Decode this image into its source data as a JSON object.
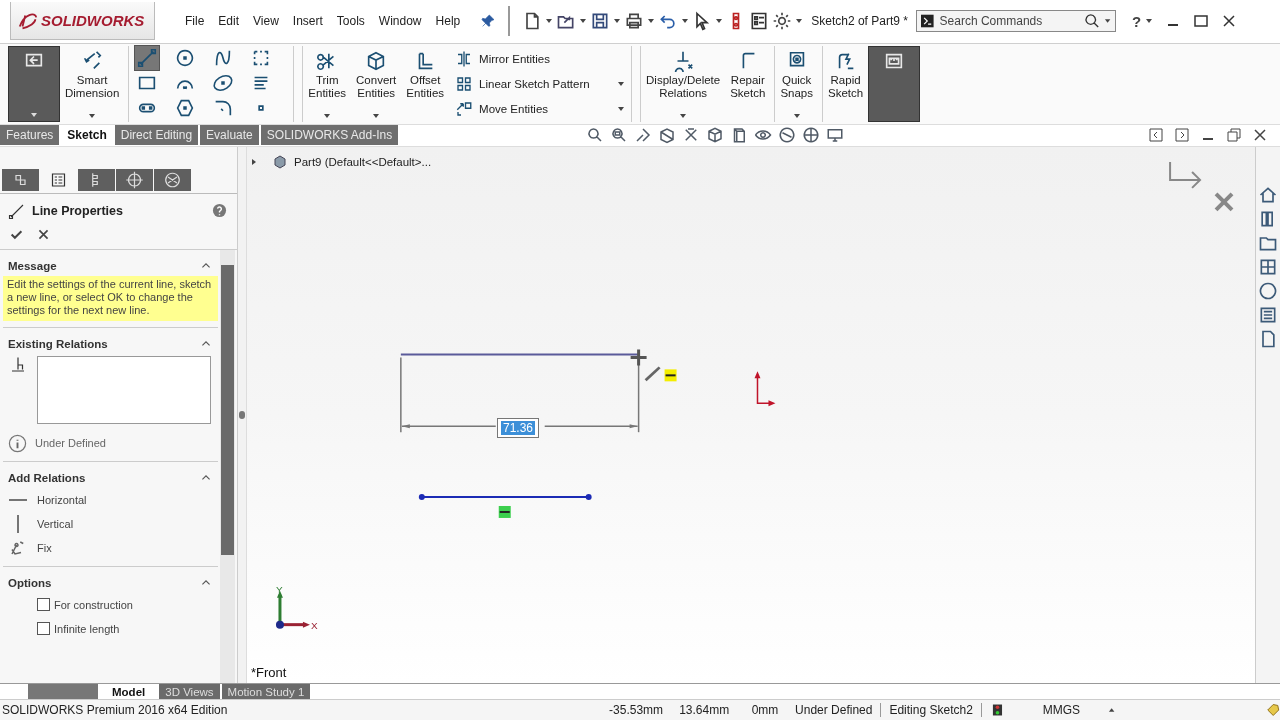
{
  "app": {
    "logo": "SOLIDWORKS"
  },
  "menu": [
    "File",
    "Edit",
    "View",
    "Insert",
    "Tools",
    "Window",
    "Help"
  ],
  "document_title": "Sketch2 of Part9 *",
  "search": {
    "placeholder": "Search Commands"
  },
  "help": "?",
  "ribbon": [
    {
      "kind": "exit",
      "selected": true,
      "dropdown": true
    },
    {
      "kind": "dimension",
      "label": "Smart\nDimension",
      "selected": false,
      "dropdown": true
    },
    {
      "kind": "tools",
      "tools": [
        {
          "kind": "line",
          "selected": true
        },
        {
          "kind": "circle",
          "selected": false
        },
        {
          "kind": "spline",
          "selected": false
        },
        {
          "kind": "dashbox",
          "selected": false
        },
        {
          "kind": "rect",
          "selected": false
        },
        {
          "kind": "arc",
          "selected": false
        },
        {
          "kind": "ellipse",
          "selected": false
        },
        {
          "kind": "text",
          "selected": false
        },
        {
          "kind": "slot",
          "selected": false
        },
        {
          "kind": "polygon",
          "selected": false
        },
        {
          "kind": "fillet",
          "selected": false
        },
        {
          "kind": "point",
          "selected": false
        }
      ]
    },
    {
      "kind": "trim",
      "label": "Trim\nEntities",
      "selected": false,
      "dropdown": true
    },
    {
      "kind": "convert",
      "label": "Convert\nEntities",
      "selected": false,
      "dropdown": true
    },
    {
      "kind": "offset",
      "label": "Offset\nEntities",
      "selected": false,
      "dropdown": false
    },
    {
      "kind": "list",
      "items": [
        {
          "kind": "mirror",
          "label": "Mirror Entities",
          "dropdown": false
        },
        {
          "kind": "pattern",
          "label": "Linear Sketch Pattern",
          "dropdown": true
        },
        {
          "kind": "move",
          "label": "Move Entities",
          "dropdown": true
        }
      ]
    },
    {
      "kind": "relations",
      "label": "Display/Delete\nRelations",
      "selected": false,
      "dropdown": true
    },
    {
      "kind": "repair",
      "label": "Repair\nSketch",
      "selected": false,
      "dropdown": false
    },
    {
      "kind": "snaps",
      "label": "Quick\nSnaps",
      "selected": false,
      "dropdown": true
    },
    {
      "kind": "rapid",
      "label": "Rapid\nSketch",
      "selected": false,
      "dropdown": false
    },
    {
      "kind": "instant",
      "selected": true,
      "dropdown": false
    }
  ],
  "command_tabs": [
    {
      "label": "Features",
      "selected": false
    },
    {
      "label": "Sketch",
      "selected": true
    },
    {
      "label": "Direct Editing",
      "selected": false
    },
    {
      "label": "Evaluate",
      "selected": false
    },
    {
      "label": "SOLIDWORKS Add-Ins",
      "selected": false
    }
  ],
  "panel": {
    "tabs": [
      {
        "kind": "features",
        "selected": false
      },
      {
        "kind": "properties",
        "selected": true
      },
      {
        "kind": "config",
        "selected": false
      },
      {
        "kind": "target",
        "selected": false
      },
      {
        "kind": "display",
        "selected": false
      }
    ],
    "title": "Line Properties",
    "message": {
      "title": "Message",
      "expanded": true,
      "text": "Edit the settings of the current line, sketch a new line, or select OK to change the settings for the next new line."
    },
    "existing_relations": {
      "title": "Existing Relations",
      "expanded": true,
      "status": "Under Defined"
    },
    "add_relations": {
      "title": "Add Relations",
      "expanded": true,
      "items": [
        {
          "kind": "horizontal",
          "label": "Horizontal"
        },
        {
          "kind": "vertical",
          "label": "Vertical"
        },
        {
          "kind": "fix",
          "label": "Fix"
        }
      ]
    },
    "options": {
      "title": "Options",
      "expanded": true,
      "items": [
        {
          "label": "For construction",
          "checked": false
        },
        {
          "label": "Infinite length",
          "checked": false
        }
      ]
    }
  },
  "tree": {
    "label": "Part9 (Default<<Default>..."
  },
  "sketch": {
    "dimension": "71.36"
  },
  "triad": {
    "x": "X",
    "y": "Y"
  },
  "view_name": "*Front",
  "bottom_tabs": [
    {
      "label": "Model",
      "selected": true
    },
    {
      "label": "3D Views",
      "selected": false
    },
    {
      "label": "Motion Study 1",
      "selected": false
    }
  ],
  "status_bar": {
    "edition": "SOLIDWORKS Premium 2016 x64 Edition",
    "x": "-35.53mm",
    "y": "13.64mm",
    "z": "0mm",
    "state": "Under Defined",
    "mode": "Editing Sketch2",
    "units": "MMGS"
  }
}
